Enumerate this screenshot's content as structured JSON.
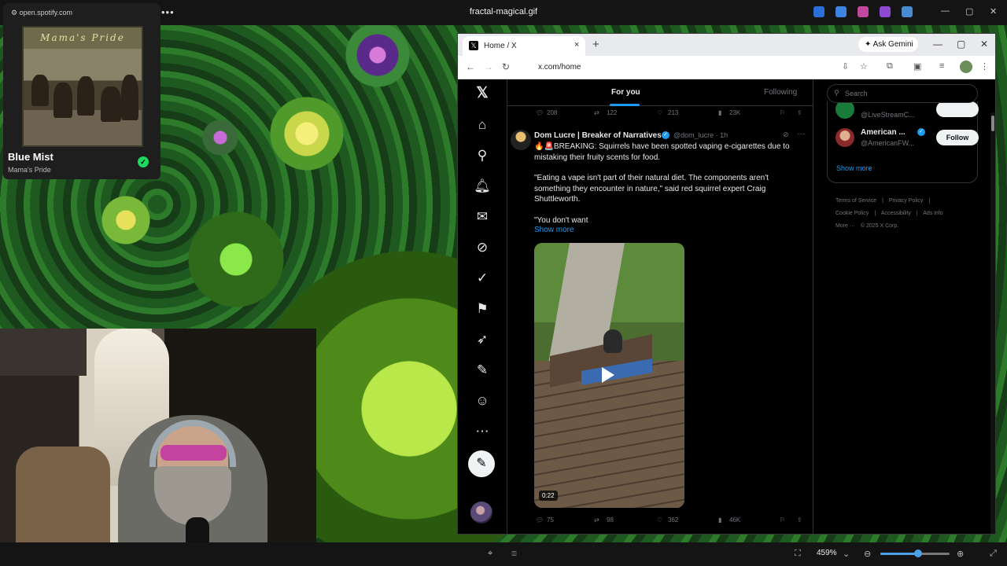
{
  "window": {
    "title": "fractal-magical.gif",
    "minimize": "—",
    "maximize": "▢",
    "close": "✕",
    "menu_dots": "•••"
  },
  "spotify": {
    "url": "open.spotify.com",
    "album_art_text": "Mama's Pride",
    "track": "Blue Mist",
    "artist": "Mama's Pride",
    "saved": true,
    "check_icon": "check-icon"
  },
  "browser": {
    "tab_label": "Home / X",
    "tab_close": "×",
    "new_tab": "+",
    "gemini_label": "Ask Gemini",
    "url": "x.com/home",
    "minimize": "—",
    "maximize": "▢",
    "close": "✕"
  },
  "x": {
    "tabs": {
      "for_you": "For you",
      "following": "Following"
    },
    "prev_post_actions": {
      "replies": "208",
      "reposts": "122",
      "likes": "213",
      "views": "23K"
    },
    "post": {
      "author": "Dom Lucre | Breaker of Narratives",
      "handle": "@dom_lucre · 1h",
      "text_1": "🔥🚨BREAKING: Squirrels have been spotted vaping e-cigarettes due to mistaking their fruity scents for food.",
      "text_2": "\"Eating a vape isn't part of their natural diet. The components aren't something they encounter in nature,\" said red squirrel expert Craig Shuttleworth.",
      "text_3": "\"You don't want",
      "show_more": "Show more",
      "video_duration": "0:22",
      "replies": "75",
      "reposts": "98",
      "likes": "362",
      "views": "46K"
    },
    "search_placeholder": "Search",
    "who_to_follow": [
      {
        "name": "",
        "handle": "@LiveStreamC...",
        "follow": ""
      },
      {
        "name": "American ...",
        "handle": "@AmericanFW...",
        "follow": "Follow"
      }
    ],
    "show_more": "Show more",
    "footer": {
      "terms": "Terms of Service",
      "sep": "|",
      "privacy": "Privacy Policy",
      "cookie": "Cookie Policy",
      "accessibility": "Accessibility",
      "ads": "Ads info",
      "more": "More ···",
      "copyright": "© 2025 X Corp."
    }
  },
  "viewer": {
    "zoom_label": "459%",
    "zoom_fraction": 0.55
  },
  "colors": {
    "x_blue": "#1d9bf0",
    "spotify_green": "#1ed760",
    "x_text": "#e7e9ea",
    "x_muted": "#71767b"
  }
}
